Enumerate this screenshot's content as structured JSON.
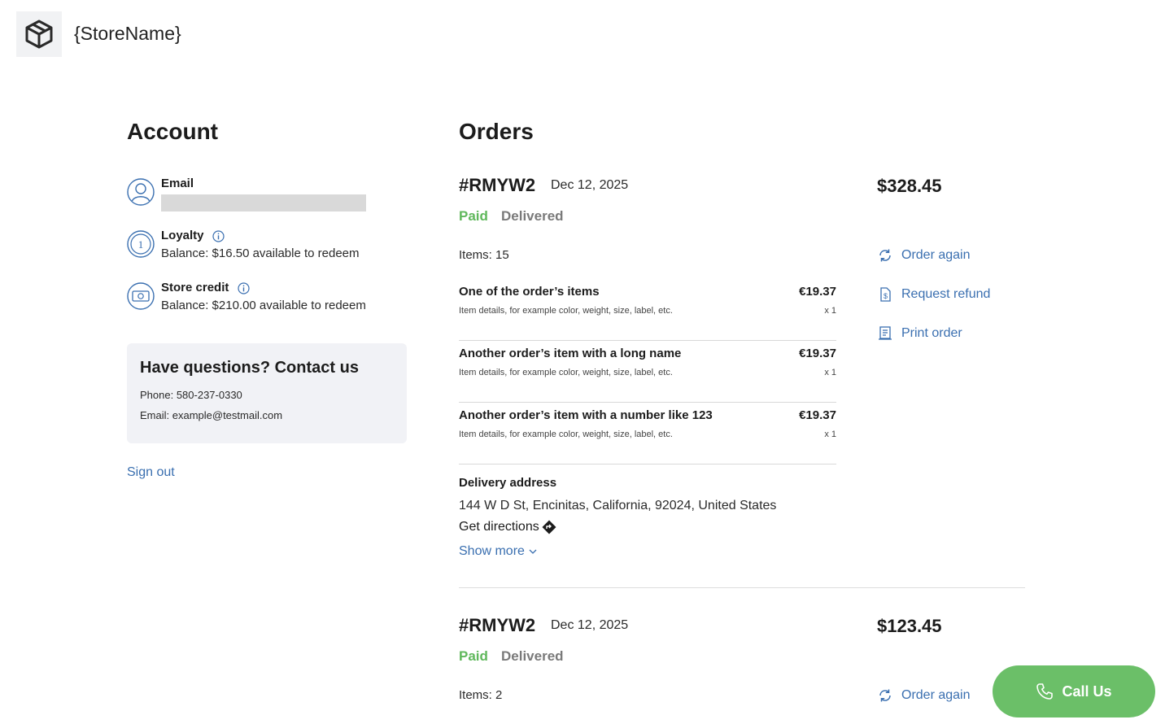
{
  "header": {
    "store_name": "{StoreName}",
    "logo_icon": "box-icon"
  },
  "account": {
    "title": "Account",
    "email_label": "Email",
    "loyalty_label": "Loyalty",
    "loyalty_balance": "Balance: $16.50 available to redeem",
    "credit_label": "Store credit",
    "credit_balance": "Balance: $210.00 available to redeem",
    "contact": {
      "title": "Have questions? Contact us",
      "phone": "Phone: 580-237-0330",
      "email": "Email: example@testmail.com"
    },
    "sign_out": "Sign out"
  },
  "orders": {
    "title": "Orders",
    "list": [
      {
        "id": "#RMYW2",
        "date": "Dec 12, 2025",
        "total": "$328.45",
        "payment_status": "Paid",
        "delivery_status": "Delivered",
        "items_count": "Items: 15",
        "items": [
          {
            "name": "One of the order’s items",
            "price": "€19.37",
            "details": "Item details, for example color, weight, size, label, etc.",
            "qty": "x 1"
          },
          {
            "name": "Another order’s item with a long name",
            "price": "€19.37",
            "details": "Item details, for example color, weight, size, label, etc.",
            "qty": "x 1"
          },
          {
            "name": "Another order’s item with a number like 123",
            "price": "€19.37",
            "details": "Item details, for example color, weight, size, label, etc.",
            "qty": "x 1"
          }
        ],
        "delivery_label": "Delivery address",
        "delivery_address": "144 W D St, Encinitas, California, 92024, United States",
        "directions": "Get directions",
        "show_more": "Show more",
        "actions": {
          "order_again": "Order again",
          "refund": "Request refund",
          "print": "Print order"
        }
      },
      {
        "id": "#RMYW2",
        "date": "Dec 12, 2025",
        "total": "$123.45",
        "payment_status": "Paid",
        "delivery_status": "Delivered",
        "items_count": "Items: 2",
        "actions": {
          "order_again": "Order again"
        }
      }
    ]
  },
  "call_button": "Call Us",
  "colors": {
    "accent_link": "#3a6fb0",
    "paid": "#5fb85b",
    "call_button": "#6bbf68",
    "card_bg": "#f1f2f6"
  }
}
